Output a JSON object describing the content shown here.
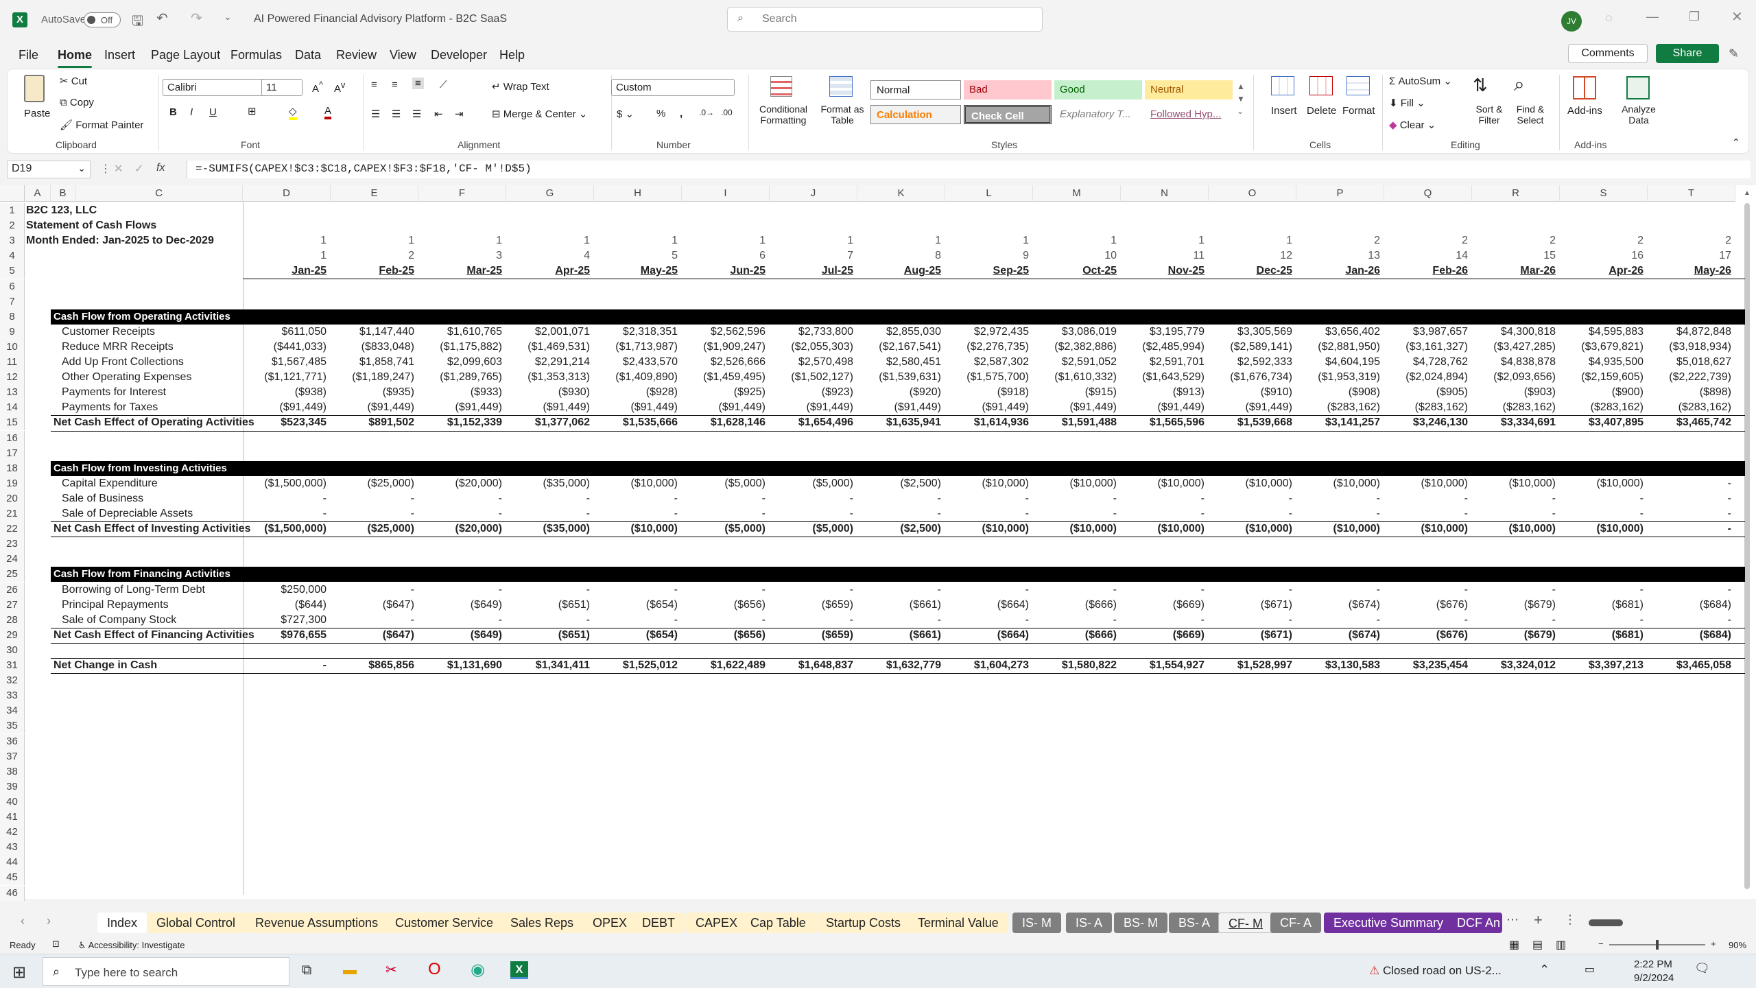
{
  "title_bar": {
    "autosave": "AutoSave",
    "toggle": "Off",
    "doc_title": "AI Powered Financial Advisory Platform - B2C SaaS",
    "search_placeholder": "Search",
    "user_initials": "JV"
  },
  "menu": {
    "items": [
      "File",
      "Home",
      "Insert",
      "Page Layout",
      "Formulas",
      "Data",
      "Review",
      "View",
      "Developer",
      "Help"
    ],
    "comments": "Comments",
    "share": "Share"
  },
  "ribbon": {
    "clipboard": {
      "paste": "Paste",
      "cut": "Cut",
      "copy": "Copy",
      "format_painter": "Format Painter",
      "label": "Clipboard"
    },
    "font": {
      "name": "Calibri",
      "size": "11",
      "label": "Font"
    },
    "alignment": {
      "wrap": "Wrap Text",
      "merge": "Merge & Center",
      "label": "Alignment"
    },
    "number": {
      "format": "Custom",
      "label": "Number"
    },
    "cond": {
      "conditional": "Conditional Formatting",
      "format_table": "Format as Table"
    },
    "styles": {
      "normal": "Normal",
      "bad": "Bad",
      "good": "Good",
      "neutral": "Neutral",
      "calculation": "Calculation",
      "check_cell": "Check Cell",
      "explanatory": "Explanatory T...",
      "followed": "Followed Hyp...",
      "label": "Styles"
    },
    "cells": {
      "insert": "Insert",
      "delete": "Delete",
      "format": "Format",
      "label": "Cells"
    },
    "editing": {
      "autosum": "AutoSum",
      "fill": "Fill",
      "clear": "Clear",
      "sort": "Sort & Filter",
      "find": "Find & Select",
      "label": "Editing"
    },
    "addins": {
      "addins": "Add-ins",
      "analyze": "Analyze Data",
      "label": "Add-ins"
    }
  },
  "formula_bar": {
    "name_box": "D19",
    "formula": "=-SUMIFS(CAPEX!$C3:$C18,CAPEX!$F3:$F18,'CF- M'!D$5)"
  },
  "columns": [
    "A",
    "B",
    "C",
    "D",
    "E",
    "F",
    "G",
    "H",
    "I",
    "J",
    "K",
    "L",
    "M",
    "N",
    "O",
    "P",
    "Q",
    "R",
    "S",
    "T"
  ],
  "row_numbers": [
    "1",
    "2",
    "3",
    "4",
    "5",
    "6",
    "7",
    "8",
    "9",
    "10",
    "11",
    "12",
    "13",
    "14",
    "15",
    "16",
    "17",
    "18",
    "19",
    "20",
    "21",
    "22",
    "23",
    "24",
    "25",
    "26",
    "27",
    "28",
    "29",
    "30",
    "31",
    "32",
    "33",
    "34",
    "35",
    "36",
    "37",
    "38",
    "39",
    "40",
    "41",
    "42",
    "43",
    "44",
    "45",
    "46"
  ],
  "sheet": {
    "company": "B2C 123, LLC",
    "statement": "Statement of Cash Flows",
    "period": "Month Ended: Jan-2025 to Dec-2029",
    "row3": [
      "1",
      "1",
      "1",
      "1",
      "1",
      "1",
      "1",
      "1",
      "1",
      "1",
      "1",
      "1",
      "2",
      "2",
      "2",
      "2",
      "2"
    ],
    "row4": [
      "1",
      "2",
      "3",
      "4",
      "5",
      "6",
      "7",
      "8",
      "9",
      "10",
      "11",
      "12",
      "13",
      "14",
      "15",
      "16",
      "17"
    ],
    "months": [
      "Jan-25",
      "Feb-25",
      "Mar-25",
      "Apr-25",
      "May-25",
      "Jun-25",
      "Jul-25",
      "Aug-25",
      "Sep-25",
      "Oct-25",
      "Nov-25",
      "Dec-25",
      "Jan-26",
      "Feb-26",
      "Mar-26",
      "Apr-26",
      "May-26"
    ],
    "sections": {
      "operating": "Cash Flow from Operating Activities",
      "investing": "Cash Flow from Investing Activities",
      "financing": "Cash Flow from Financing Activities"
    },
    "rows": [
      {
        "r": 9,
        "label": "Customer Receipts",
        "vals": [
          "$611,050",
          "$1,147,440",
          "$1,610,765",
          "$2,001,071",
          "$2,318,351",
          "$2,562,596",
          "$2,733,800",
          "$2,855,030",
          "$2,972,435",
          "$3,086,019",
          "$3,195,779",
          "$3,305,569",
          "$3,656,402",
          "$3,987,657",
          "$4,300,818",
          "$4,595,883",
          "$4,872,848"
        ]
      },
      {
        "r": 10,
        "label": "Reduce MRR Receipts",
        "vals": [
          "($441,033)",
          "($833,048)",
          "($1,175,882)",
          "($1,469,531)",
          "($1,713,987)",
          "($1,909,247)",
          "($2,055,303)",
          "($2,167,541)",
          "($2,276,735)",
          "($2,382,886)",
          "($2,485,994)",
          "($2,589,141)",
          "($2,881,950)",
          "($3,161,327)",
          "($3,427,285)",
          "($3,679,821)",
          "($3,918,934)"
        ]
      },
      {
        "r": 11,
        "label": "Add Up Front Collections",
        "vals": [
          "$1,567,485",
          "$1,858,741",
          "$2,099,603",
          "$2,291,214",
          "$2,433,570",
          "$2,526,666",
          "$2,570,498",
          "$2,580,451",
          "$2,587,302",
          "$2,591,052",
          "$2,591,701",
          "$2,592,333",
          "$4,604,195",
          "$4,728,762",
          "$4,838,878",
          "$4,935,500",
          "$5,018,627"
        ]
      },
      {
        "r": 12,
        "label": "Other Operating Expenses",
        "vals": [
          "($1,121,771)",
          "($1,189,247)",
          "($1,289,765)",
          "($1,353,313)",
          "($1,409,890)",
          "($1,459,495)",
          "($1,502,127)",
          "($1,539,631)",
          "($1,575,700)",
          "($1,610,332)",
          "($1,643,529)",
          "($1,676,734)",
          "($1,953,319)",
          "($2,024,894)",
          "($2,093,656)",
          "($2,159,605)",
          "($2,222,739)"
        ]
      },
      {
        "r": 13,
        "label": "Payments for Interest",
        "vals": [
          "($938)",
          "($935)",
          "($933)",
          "($930)",
          "($928)",
          "($925)",
          "($923)",
          "($920)",
          "($918)",
          "($915)",
          "($913)",
          "($910)",
          "($908)",
          "($905)",
          "($903)",
          "($900)",
          "($898)"
        ]
      },
      {
        "r": 14,
        "label": "Payments for Taxes",
        "vals": [
          "($91,449)",
          "($91,449)",
          "($91,449)",
          "($91,449)",
          "($91,449)",
          "($91,449)",
          "($91,449)",
          "($91,449)",
          "($91,449)",
          "($91,449)",
          "($91,449)",
          "($91,449)",
          "($283,162)",
          "($283,162)",
          "($283,162)",
          "($283,162)",
          "($283,162)"
        ]
      },
      {
        "r": 15,
        "label": "Net Cash Effect of Operating Activities",
        "bold": true,
        "vals": [
          "$523,345",
          "$891,502",
          "$1,152,339",
          "$1,377,062",
          "$1,535,666",
          "$1,628,146",
          "$1,654,496",
          "$1,635,941",
          "$1,614,936",
          "$1,591,488",
          "$1,565,596",
          "$1,539,668",
          "$3,141,257",
          "$3,246,130",
          "$3,334,691",
          "$3,407,895",
          "$3,465,742"
        ]
      },
      {
        "r": 19,
        "label": "Capital Expenditure",
        "vals": [
          "($1,500,000)",
          "($25,000)",
          "($20,000)",
          "($35,000)",
          "($10,000)",
          "($5,000)",
          "($5,000)",
          "($2,500)",
          "($10,000)",
          "($10,000)",
          "($10,000)",
          "($10,000)",
          "($10,000)",
          "($10,000)",
          "($10,000)",
          "($10,000)",
          "-"
        ]
      },
      {
        "r": 20,
        "label": "Sale of Business",
        "vals": [
          "-",
          "-",
          "-",
          "-",
          "-",
          "-",
          "-",
          "-",
          "-",
          "-",
          "-",
          "-",
          "-",
          "-",
          "-",
          "-",
          "-"
        ]
      },
      {
        "r": 21,
        "label": "Sale of Depreciable Assets",
        "vals": [
          "-",
          "-",
          "-",
          "-",
          "-",
          "-",
          "-",
          "-",
          "-",
          "-",
          "-",
          "-",
          "-",
          "-",
          "-",
          "-",
          "-"
        ]
      },
      {
        "r": 22,
        "label": "Net Cash Effect of Investing Activities",
        "bold": true,
        "vals": [
          "($1,500,000)",
          "($25,000)",
          "($20,000)",
          "($35,000)",
          "($10,000)",
          "($5,000)",
          "($5,000)",
          "($2,500)",
          "($10,000)",
          "($10,000)",
          "($10,000)",
          "($10,000)",
          "($10,000)",
          "($10,000)",
          "($10,000)",
          "($10,000)",
          "-"
        ]
      },
      {
        "r": 26,
        "label": "Borrowing of Long-Term Debt",
        "vals": [
          "$250,000",
          "-",
          "-",
          "-",
          "-",
          "-",
          "-",
          "-",
          "-",
          "-",
          "-",
          "-",
          "-",
          "-",
          "-",
          "-",
          "-"
        ]
      },
      {
        "r": 27,
        "label": "Principal Repayments",
        "vals": [
          "($644)",
          "($647)",
          "($649)",
          "($651)",
          "($654)",
          "($656)",
          "($659)",
          "($661)",
          "($664)",
          "($666)",
          "($669)",
          "($671)",
          "($674)",
          "($676)",
          "($679)",
          "($681)",
          "($684)"
        ]
      },
      {
        "r": 28,
        "label": "Sale of Company Stock",
        "vals": [
          "$727,300",
          "-",
          "-",
          "-",
          "-",
          "-",
          "-",
          "-",
          "-",
          "-",
          "-",
          "-",
          "-",
          "-",
          "-",
          "-",
          "-"
        ]
      },
      {
        "r": 29,
        "label": "Net Cash Effect of Financing Activities",
        "bold": true,
        "vals": [
          "$976,655",
          "($647)",
          "($649)",
          "($651)",
          "($654)",
          "($656)",
          "($659)",
          "($661)",
          "($664)",
          "($666)",
          "($669)",
          "($671)",
          "($674)",
          "($676)",
          "($679)",
          "($681)",
          "($684)"
        ]
      },
      {
        "r": 31,
        "label": "Net Change in Cash",
        "bold": true,
        "vals": [
          "-",
          "$865,856",
          "$1,131,690",
          "$1,341,411",
          "$1,525,012",
          "$1,622,489",
          "$1,648,837",
          "$1,632,779",
          "$1,604,273",
          "$1,580,822",
          "$1,554,927",
          "$1,528,997",
          "$3,130,583",
          "$3,235,454",
          "$3,324,012",
          "$3,397,213",
          "$3,465,058"
        ]
      }
    ]
  },
  "tabs": [
    "Index",
    "Global Control",
    "Revenue Assumptions",
    "Customer Service",
    "Sales Reps",
    "OPEX",
    "DEBT",
    "CAPEX",
    "Cap Table",
    "Startup Costs",
    "Terminal Value",
    "IS- M",
    "IS- A",
    "BS- M",
    "BS- A",
    "CF- M",
    "CF- A",
    "Executive Summary",
    "DCF An"
  ],
  "tab_colors": {
    "yellow": "#fff2cc",
    "gray": "#7f7f7f",
    "purple": "#7030a0",
    "active": "#ffffff"
  },
  "status": {
    "ready": "Ready",
    "accessibility": "Accessibility: Investigate",
    "zoom": "90%"
  },
  "taskbar": {
    "search_placeholder": "Type here to search",
    "news": "Closed road on US-2...",
    "time": "2:22 PM",
    "date": "9/2/2024"
  },
  "colors": {
    "excel_green": "#107c41",
    "section_bar": "#000000",
    "bad_bg": "#ffc7ce",
    "good_bg": "#c6efce",
    "neutral_bg": "#ffeb9c"
  }
}
